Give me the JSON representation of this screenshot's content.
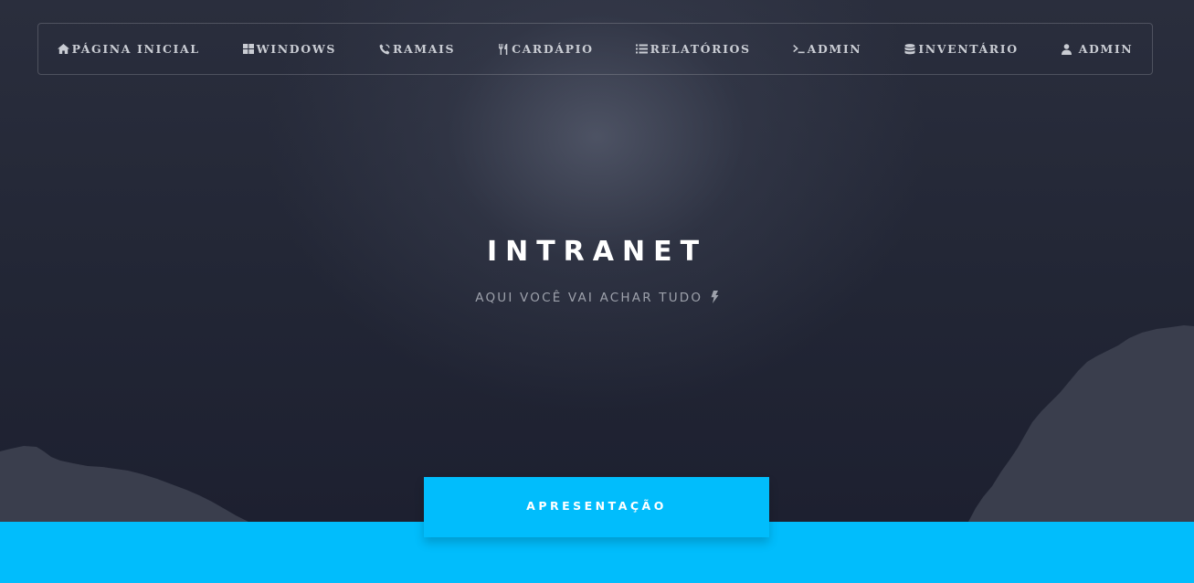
{
  "nav": {
    "items": [
      {
        "label": "PÁGINA INICIAL",
        "icon": "home-icon"
      },
      {
        "label": "WINDOWS",
        "icon": "windows-icon"
      },
      {
        "label": "RAMAIS",
        "icon": "phone-icon"
      },
      {
        "label": "CARDÁPIO",
        "icon": "cutlery-icon"
      },
      {
        "label": "RELATÓRIOS",
        "icon": "list-icon"
      },
      {
        "label": "ADMIN",
        "icon": "terminal-icon"
      },
      {
        "label": "INVENTÁRIO",
        "icon": "database-icon"
      },
      {
        "label": "ADMIN",
        "icon": "user-icon"
      }
    ]
  },
  "hero": {
    "title": "INTRANET",
    "subtitle": "AQUI VOCÊ VAI ACHAR TUDO",
    "subtitle_icon": "bolt-icon"
  },
  "tab": {
    "label": "APRESENTAÇÃO"
  },
  "colors": {
    "accent": "#01bdfc",
    "background": "#1f2230",
    "nav_text": "#c9ccd3",
    "subtitle_text": "#9da1ab"
  }
}
